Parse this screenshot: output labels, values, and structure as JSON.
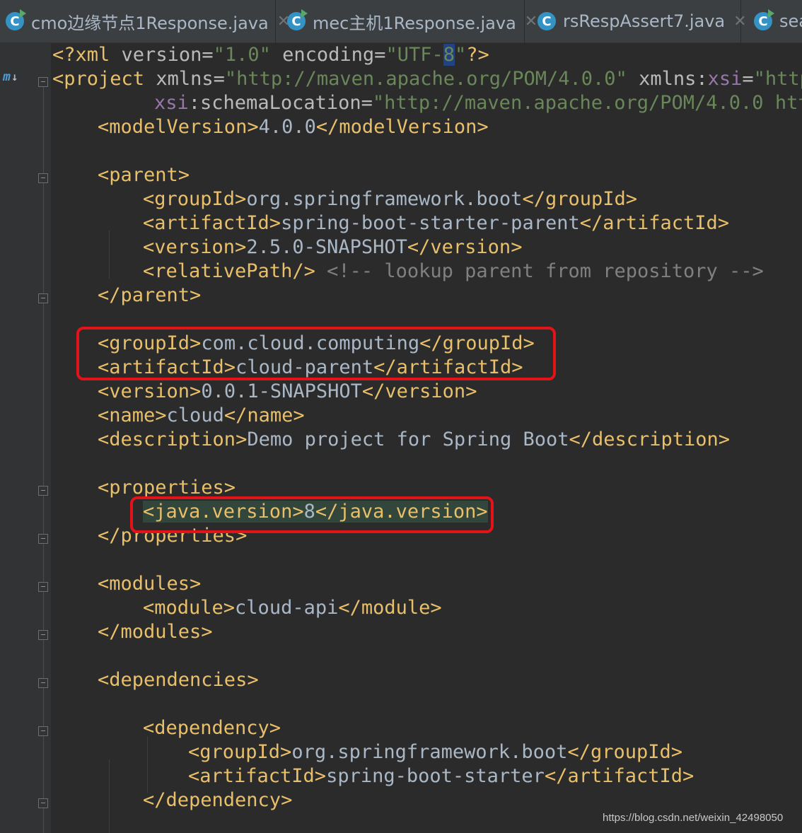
{
  "tabs": [
    {
      "label": "cmo边缘节点1Response.java",
      "icon": "java-class-runnable-icon"
    },
    {
      "label": "mec主机1Response.java",
      "icon": "java-class-runnable-icon"
    },
    {
      "label": "rsRespAssert7.java",
      "icon": "java-class-icon"
    },
    {
      "label": "sea",
      "icon": "java-class-runnable-icon"
    }
  ],
  "close_glyph": "✕",
  "gutter": {
    "maven_marker": "m"
  },
  "code": {
    "l1": [
      "<?xml ",
      "version=",
      "\"1.0\"",
      " encoding=",
      "\"UTF-",
      "8",
      "\"",
      "?>"
    ],
    "l2": [
      "<project ",
      "xmlns=",
      "\"http://maven.apache.org/POM/4.0.0\"",
      " xmlns:",
      "xsi",
      "=",
      "\"http"
    ],
    "l3": [
      "xsi",
      ":schemaLocation=",
      "\"http://maven.apache.org/POM/4.0.0 http"
    ],
    "l4": [
      "<modelVersion>",
      "4.0.0",
      "</modelVersion>"
    ],
    "l6": "<parent>",
    "l7": [
      "<groupId>",
      "org.springframework.boot",
      "</groupId>"
    ],
    "l8": [
      "<artifactId>",
      "spring-boot-starter-parent",
      "</artifactId>"
    ],
    "l9": [
      "<version>",
      "2.5.0-SNAPSHOT",
      "</version>"
    ],
    "l10": [
      "<relativePath/>",
      " <!-- lookup parent from repository -->"
    ],
    "l11": "</parent>",
    "l13": [
      "<groupId>",
      "com.cloud.computing",
      "</groupId>"
    ],
    "l14": [
      "<artifactId>",
      "cloud-parent",
      "</artifactId>"
    ],
    "l15": [
      "<version>",
      "0.0.1-SNAPSHOT",
      "</version>"
    ],
    "l16": [
      "<name>",
      "cloud",
      "</name>"
    ],
    "l17": [
      "<description>",
      "Demo project for Spring Boot",
      "</description>"
    ],
    "l19": "<properties>",
    "l20": [
      "<java.version>",
      "8",
      "</java.version>"
    ],
    "l21": "</properties>",
    "l23": "<modules>",
    "l24": [
      "<module>",
      "cloud-api",
      "</module>"
    ],
    "l25": "</modules>",
    "l27": "<dependencies>",
    "l29": "<dependency>",
    "l30": [
      "<groupId>",
      "org.springframework.boot",
      "</groupId>"
    ],
    "l31": [
      "<artifactId>",
      "spring-boot-starter",
      "</artifactId>"
    ],
    "l32": "</dependency>"
  },
  "highlight_color": "#e3131a",
  "watermark": "https://blog.csdn.net/weixin_42498050"
}
